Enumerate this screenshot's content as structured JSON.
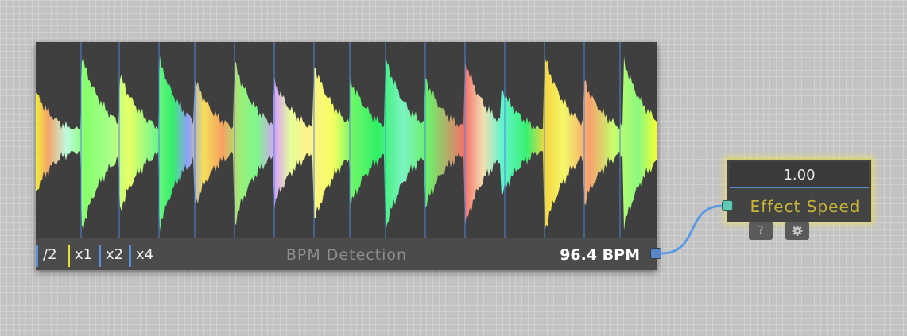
{
  "bpm_node": {
    "title": "BPM Detection",
    "bpm_value": "96.4 BPM",
    "multipliers": [
      {
        "label": "/2",
        "color": "#5b8fe0"
      },
      {
        "label": "x1",
        "color": "#e6dd3a"
      },
      {
        "label": "x2",
        "color": "#5b8fe0"
      },
      {
        "label": "x4",
        "color": "#5b8fe0"
      }
    ],
    "beat_line_color": "#4f86d8"
  },
  "speed_node": {
    "value": "1.00",
    "label": "Effect Speed",
    "help_button": "?",
    "settings_icon": "gear-icon",
    "highlight_color": "#e6dc6e",
    "label_color": "#c5b53b"
  },
  "wire_color": "#5b9be6"
}
